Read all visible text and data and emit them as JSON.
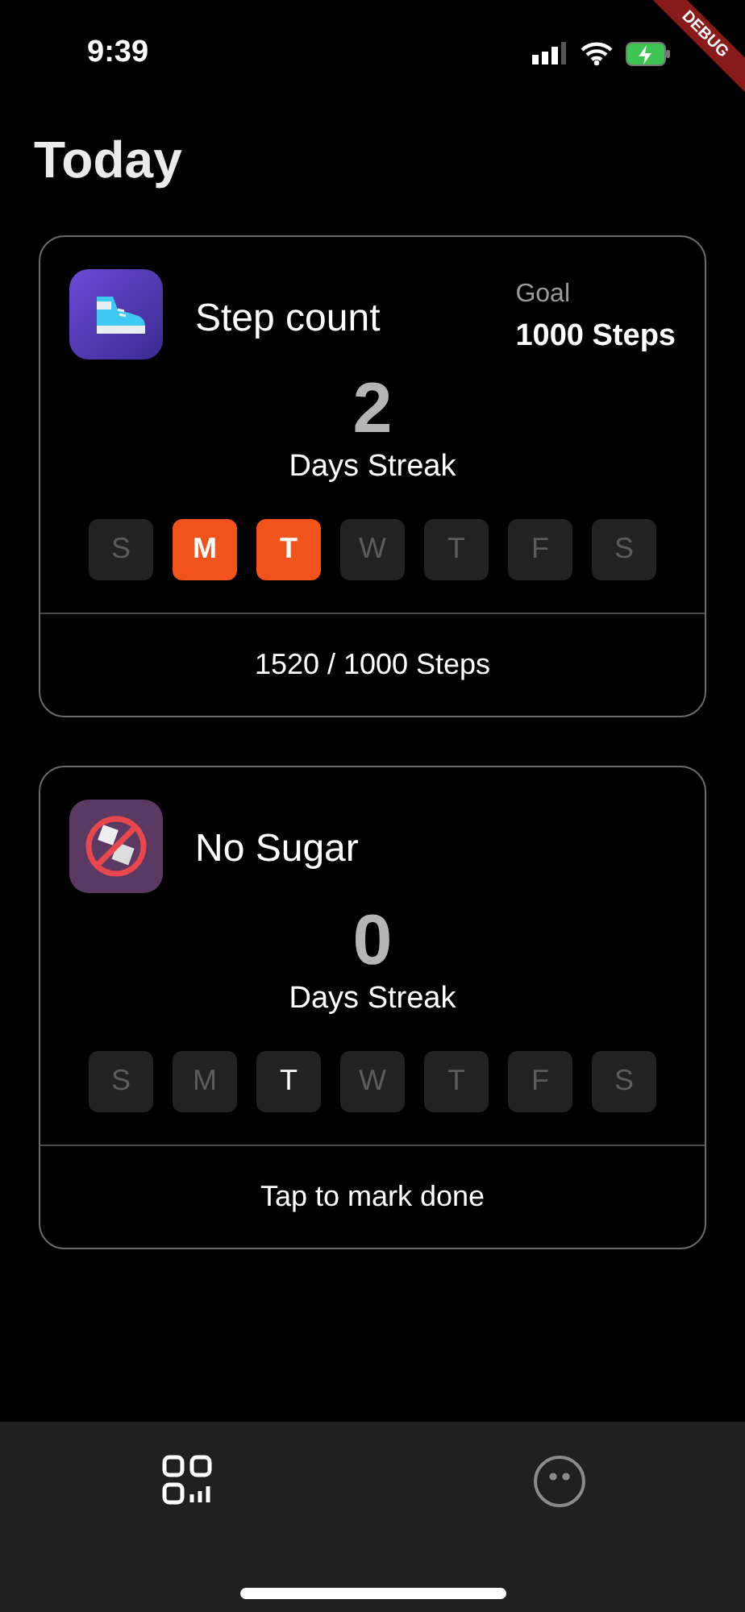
{
  "status_bar": {
    "time": "9:39"
  },
  "debug_banner": "DEBUG",
  "title": "Today",
  "habits": [
    {
      "kind": "steps",
      "name": "Step count",
      "goal_label": "Goal",
      "goal_value": "1000 Steps",
      "streak": "2",
      "streak_label": "Days Streak",
      "days": [
        {
          "label": "S",
          "done": false
        },
        {
          "label": "M",
          "done": true
        },
        {
          "label": "T",
          "done": true
        },
        {
          "label": "W",
          "done": false
        },
        {
          "label": "T",
          "done": false
        },
        {
          "label": "F",
          "done": false
        },
        {
          "label": "S",
          "done": false
        }
      ],
      "footer": "1520 / 1000 Steps"
    },
    {
      "kind": "sugar",
      "name": "No Sugar",
      "streak": "0",
      "streak_label": "Days Streak",
      "days": [
        {
          "label": "S",
          "done": false,
          "today": false
        },
        {
          "label": "M",
          "done": false,
          "today": false
        },
        {
          "label": "T",
          "done": false,
          "today": true
        },
        {
          "label": "W",
          "done": false,
          "today": false
        },
        {
          "label": "T",
          "done": false,
          "today": false
        },
        {
          "label": "F",
          "done": false,
          "today": false
        },
        {
          "label": "S",
          "done": false,
          "today": false
        }
      ],
      "footer": "Tap to mark done"
    }
  ],
  "tabs": [
    {
      "kind": "dashboard",
      "selected": true
    },
    {
      "kind": "profile",
      "selected": false
    }
  ]
}
